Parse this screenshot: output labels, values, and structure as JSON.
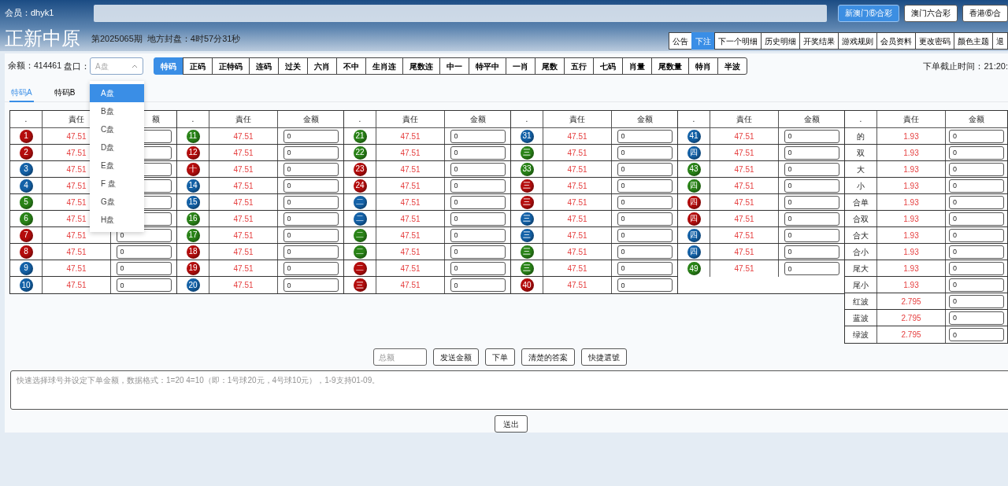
{
  "header": {
    "member": "会员：dhyk1",
    "lottery_tabs": [
      {
        "label": "新澳门⑥合彩",
        "selected": true
      },
      {
        "label": "澳门六合彩",
        "selected": false
      },
      {
        "label": "香港⑥合",
        "selected": false
      }
    ],
    "title": "正新中原",
    "period": "第2025065期",
    "countdown": "地方封盘：4时57分31秒",
    "nav": [
      {
        "label": "公告",
        "selected": false
      },
      {
        "label": "下注",
        "selected": true
      },
      {
        "label": "下一个明细",
        "selected": false
      },
      {
        "label": "历史明细",
        "selected": false
      },
      {
        "label": "开奖结果",
        "selected": false
      },
      {
        "label": "游戏规则",
        "selected": false
      },
      {
        "label": "会员资料",
        "selected": false
      },
      {
        "label": "更改密码",
        "selected": false
      },
      {
        "label": "颜色主题",
        "selected": false
      },
      {
        "label": "退",
        "selected": false
      }
    ]
  },
  "toolbar": {
    "balance": "余额：414461",
    "market_label": "盘口：",
    "market_value": "A盘",
    "game_tabs": [
      {
        "label": "特码",
        "selected": true
      },
      {
        "label": "正码",
        "selected": false
      },
      {
        "label": "正特码",
        "selected": false
      },
      {
        "label": "连码",
        "selected": false
      },
      {
        "label": "过关",
        "selected": false
      },
      {
        "label": "六肖",
        "selected": false
      },
      {
        "label": "不中",
        "selected": false
      },
      {
        "label": "生肖连",
        "selected": false
      },
      {
        "label": "尾数连",
        "selected": false
      },
      {
        "label": "中一",
        "selected": false
      },
      {
        "label": "特平中",
        "selected": false
      },
      {
        "label": "一肖",
        "selected": false
      },
      {
        "label": "尾数",
        "selected": false
      },
      {
        "label": "五行",
        "selected": false
      },
      {
        "label": "七码",
        "selected": false
      },
      {
        "label": "肖量",
        "selected": false
      },
      {
        "label": "尾数量",
        "selected": false
      },
      {
        "label": "特肖",
        "selected": false
      },
      {
        "label": "半波",
        "selected": false
      }
    ],
    "deadline": "下单截止时间：21:20:"
  },
  "market_dropdown": [
    {
      "label": "A盘",
      "selected": true
    },
    {
      "label": "B盘",
      "selected": false
    },
    {
      "label": "C盘",
      "selected": false
    },
    {
      "label": "D盘",
      "selected": false
    },
    {
      "label": "E盘",
      "selected": false
    },
    {
      "label": "F 盘",
      "selected": false
    },
    {
      "label": "G盘",
      "selected": false
    },
    {
      "label": "H盘",
      "selected": false
    }
  ],
  "sub_tabs": [
    {
      "label": "特码A",
      "selected": true
    },
    {
      "label": "特码B",
      "selected": false
    }
  ],
  "table": {
    "groups": [
      {
        "kind": "balls",
        "headers": [
          ".",
          "責任",
          "额"
        ],
        "rows": [
          {
            "ball": "1",
            "color": "#b50d0d",
            "odds": "47.51"
          },
          {
            "ball": "2",
            "color": "#b50d0d",
            "odds": "47.51"
          },
          {
            "ball": "3",
            "color": "#1462a8",
            "odds": "47.51"
          },
          {
            "ball": "4",
            "color": "#1462a8",
            "odds": "47.51"
          },
          {
            "ball": "5",
            "color": "#2a8418",
            "odds": "47.51"
          },
          {
            "ball": "6",
            "color": "#2a8418",
            "odds": "47.51"
          },
          {
            "ball": "7",
            "color": "#b50d0d",
            "odds": "47.51",
            "amount": "0"
          },
          {
            "ball": "8",
            "color": "#b50d0d",
            "odds": "47.51",
            "amount": "0"
          },
          {
            "ball": "9",
            "color": "#1462a8",
            "odds": "47.51",
            "amount": "0"
          },
          {
            "ball": "10",
            "color": "#1462a8",
            "odds": "47.51",
            "amount": "0"
          }
        ]
      },
      {
        "kind": "balls",
        "headers": [
          ".",
          "責任",
          "金额"
        ],
        "rows": [
          {
            "ball": "11",
            "color": "#2a8418",
            "odds": "47.51",
            "amount": "0"
          },
          {
            "ball": "12",
            "color": "#b50d0d",
            "odds": "47.51",
            "amount": "0"
          },
          {
            "ball": "十",
            "color": "#b50d0d",
            "odds": "47.51",
            "amount": "0"
          },
          {
            "ball": "14",
            "color": "#1462a8",
            "odds": "47.51",
            "amount": "0"
          },
          {
            "ball": "15",
            "color": "#1462a8",
            "odds": "47.51",
            "amount": "0"
          },
          {
            "ball": "16",
            "color": "#2a8418",
            "odds": "47.51",
            "amount": "0"
          },
          {
            "ball": "17",
            "color": "#2a8418",
            "odds": "47.51",
            "amount": "0"
          },
          {
            "ball": "18",
            "color": "#b50d0d",
            "odds": "47.51",
            "amount": "0"
          },
          {
            "ball": "19",
            "color": "#b50d0d",
            "odds": "47.51",
            "amount": "0"
          },
          {
            "ball": "20",
            "color": "#1462a8",
            "odds": "47.51",
            "amount": "0"
          }
        ]
      },
      {
        "kind": "balls",
        "headers": [
          ".",
          "責任",
          "金额"
        ],
        "rows": [
          {
            "ball": "21",
            "color": "#2a8418",
            "odds": "47.51",
            "amount": "0"
          },
          {
            "ball": "22",
            "color": "#2a8418",
            "odds": "47.51",
            "amount": "0"
          },
          {
            "ball": "23",
            "color": "#b50d0d",
            "odds": "47.51",
            "amount": "0"
          },
          {
            "ball": "24",
            "color": "#b50d0d",
            "odds": "47.51",
            "amount": "0"
          },
          {
            "ball": "二",
            "color": "#1462a8",
            "odds": "47.51",
            "amount": "0"
          },
          {
            "ball": "二",
            "color": "#1462a8",
            "odds": "47.51",
            "amount": "0"
          },
          {
            "ball": "二",
            "color": "#2a8418",
            "odds": "47.51",
            "amount": "0"
          },
          {
            "ball": "二",
            "color": "#2a8418",
            "odds": "47.51",
            "amount": "0"
          },
          {
            "ball": "二",
            "color": "#b50d0d",
            "odds": "47.51",
            "amount": "0"
          },
          {
            "ball": "三",
            "color": "#b50d0d",
            "odds": "47.51",
            "amount": "0"
          }
        ]
      },
      {
        "kind": "balls",
        "headers": [
          ".",
          "責任",
          "金额"
        ],
        "rows": [
          {
            "ball": "31",
            "color": "#1462a8",
            "odds": "47.51",
            "amount": "0"
          },
          {
            "ball": "三",
            "color": "#2a8418",
            "odds": "47.51",
            "amount": "0"
          },
          {
            "ball": "33",
            "color": "#2a8418",
            "odds": "47.51",
            "amount": "0"
          },
          {
            "ball": "三",
            "color": "#b50d0d",
            "odds": "47.51",
            "amount": "0"
          },
          {
            "ball": "三",
            "color": "#b50d0d",
            "odds": "47.51",
            "amount": "0"
          },
          {
            "ball": "三",
            "color": "#1462a8",
            "odds": "47.51",
            "amount": "0"
          },
          {
            "ball": "三",
            "color": "#1462a8",
            "odds": "47.51",
            "amount": "0"
          },
          {
            "ball": "三",
            "color": "#2a8418",
            "odds": "47.51",
            "amount": "0"
          },
          {
            "ball": "三",
            "color": "#2a8418",
            "odds": "47.51",
            "amount": "0"
          },
          {
            "ball": "40",
            "color": "#b50d0d",
            "odds": "47.51",
            "amount": "0"
          }
        ]
      },
      {
        "kind": "balls",
        "headers": [
          ".",
          "責任",
          "金额"
        ],
        "rows": [
          {
            "ball": "41",
            "color": "#1462a8",
            "odds": "47.51",
            "amount": "0"
          },
          {
            "ball": "四",
            "color": "#1462a8",
            "odds": "47.51",
            "amount": "0"
          },
          {
            "ball": "43",
            "color": "#2a8418",
            "odds": "47.51",
            "amount": "0"
          },
          {
            "ball": "四",
            "color": "#2a8418",
            "odds": "47.51",
            "amount": "0"
          },
          {
            "ball": "四",
            "color": "#b50d0d",
            "odds": "47.51",
            "amount": "0"
          },
          {
            "ball": "四",
            "color": "#b50d0d",
            "odds": "47.51",
            "amount": "0"
          },
          {
            "ball": "四",
            "color": "#1462a8",
            "odds": "47.51",
            "amount": "0"
          },
          {
            "ball": "四",
            "color": "#1462a8",
            "odds": "47.51",
            "amount": "0"
          },
          {
            "ball": "49",
            "color": "#2a8418",
            "odds": "47.51",
            "amount": "0"
          }
        ]
      },
      {
        "kind": "labels",
        "headers": [
          ".",
          "責任",
          "金额"
        ],
        "rows": [
          {
            "label": "的",
            "odds": "1.93",
            "amount": "0"
          },
          {
            "label": "双",
            "odds": "1.93",
            "amount": "0"
          },
          {
            "label": "大",
            "odds": "1.93",
            "amount": "0"
          },
          {
            "label": "小",
            "odds": "1.93",
            "amount": "0"
          },
          {
            "label": "合单",
            "odds": "1.93",
            "amount": "0"
          },
          {
            "label": "合双",
            "odds": "1.93",
            "amount": "0"
          },
          {
            "label": "合大",
            "odds": "1.93",
            "amount": "0"
          },
          {
            "label": "合小",
            "odds": "1.93",
            "amount": "0"
          },
          {
            "label": "尾大",
            "odds": "1.93",
            "amount": "0"
          },
          {
            "label": "尾小",
            "odds": "1.93",
            "amount": "0"
          },
          {
            "label": "红波",
            "odds": "2.795",
            "amount": "0"
          },
          {
            "label": "蓝波",
            "odds": "2.795",
            "amount": "0"
          },
          {
            "label": "绿波",
            "odds": "2.795",
            "amount": "0"
          }
        ]
      }
    ]
  },
  "actions": {
    "total_placeholder": "总额",
    "buttons": [
      "发送金额",
      "下单",
      "清楚的答案",
      "快捷選號"
    ]
  },
  "quick_input": {
    "placeholder": "快速选择球号并设定下单金额，数据格式：1=20 4=10（即：1号球20元，4号球10元），1-9支持01-09。"
  },
  "submit": "送出"
}
